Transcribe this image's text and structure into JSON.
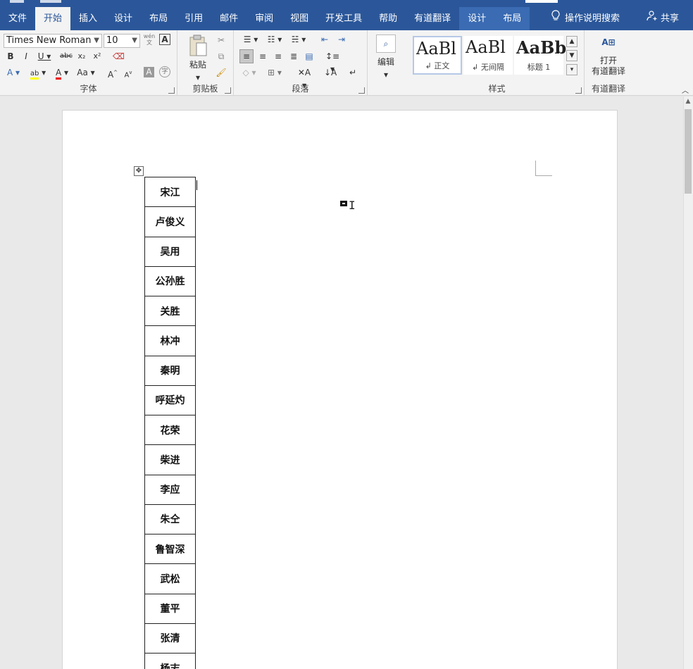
{
  "tabs": [
    "文件",
    "开始",
    "插入",
    "设计",
    "布局",
    "引用",
    "邮件",
    "审阅",
    "视图",
    "开发工具",
    "帮助",
    "有道翻译",
    "设计",
    "布局"
  ],
  "active_tab_index": 1,
  "tell_me": "操作说明搜索",
  "share": "共享",
  "font": {
    "name": "Times New Roman",
    "size": "10",
    "group_label": "字体"
  },
  "clipboard": {
    "paste": "粘贴",
    "group_label": "剪贴板"
  },
  "paragraph": {
    "group_label": "段落"
  },
  "styles": {
    "group_label": "样式",
    "items": [
      {
        "preview": "AaBl",
        "label": "正文"
      },
      {
        "preview": "AaBl",
        "label": "无间隔"
      },
      {
        "preview": "AaBb",
        "label": "标题 1"
      }
    ]
  },
  "editing": {
    "label": "编辑"
  },
  "youdao": {
    "open_label": "打开",
    "open_label2": "有道翻译",
    "group_label": "有道翻译"
  },
  "table_names": [
    "宋江",
    "卢俊义",
    "吴用",
    "公孙胜",
    "关胜",
    "林冲",
    "秦明",
    "呼延灼",
    "花荣",
    "柴进",
    "李应",
    "朱仝",
    "鲁智深",
    "武松",
    "董平",
    "张清",
    "杨志"
  ]
}
